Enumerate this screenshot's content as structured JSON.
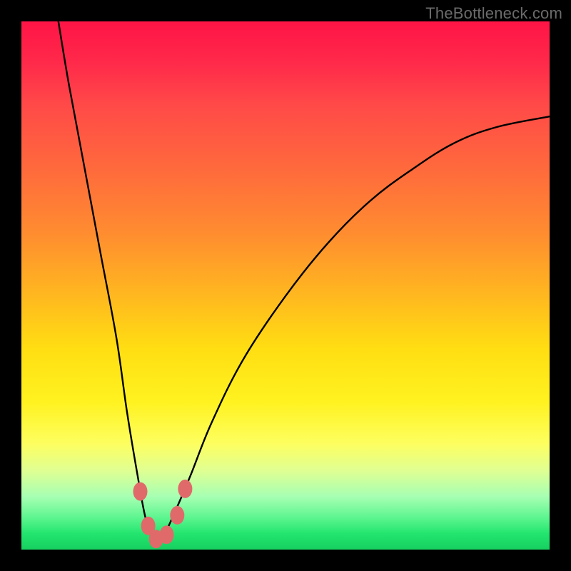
{
  "watermark": "TheBottleneck.com",
  "chart_data": {
    "type": "line",
    "title": "",
    "xlabel": "",
    "ylabel": "",
    "x_range": [
      0,
      100
    ],
    "y_range": [
      0,
      100
    ],
    "series": [
      {
        "name": "bottleneck-curve",
        "x": [
          7,
          9,
          12,
          15,
          18,
          20,
          22,
          23.5,
          25,
          27,
          29,
          32,
          36,
          42,
          50,
          58,
          66,
          74,
          82,
          90,
          100
        ],
        "y": [
          100,
          88,
          72,
          56,
          40,
          26,
          14,
          6,
          2,
          3,
          7,
          14,
          24,
          36,
          48,
          58,
          66,
          72,
          77,
          80,
          82
        ]
      }
    ],
    "markers": [
      {
        "name": "marker-left-top",
        "x": 22.5,
        "y": 11
      },
      {
        "name": "marker-left-mid",
        "x": 24.0,
        "y": 4.5
      },
      {
        "name": "marker-bottom-1",
        "x": 25.5,
        "y": 2.0
      },
      {
        "name": "marker-bottom-2",
        "x": 27.5,
        "y": 2.8
      },
      {
        "name": "marker-right-low",
        "x": 29.5,
        "y": 6.5
      },
      {
        "name": "marker-right-top",
        "x": 31.0,
        "y": 11.5
      }
    ],
    "marker_color": "#e06a6a",
    "curve_color": "#000000"
  }
}
